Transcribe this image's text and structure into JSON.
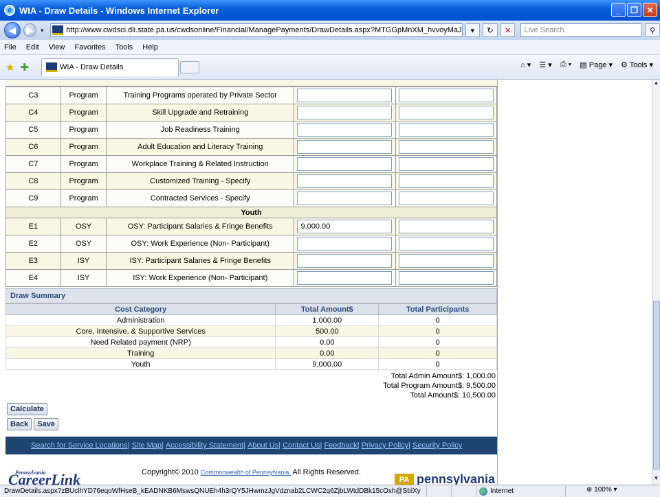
{
  "window": {
    "title": "WIA - Draw Details - Windows Internet Explorer"
  },
  "browser": {
    "url": "http://www.cwdsci.dli.state.pa.us/cwdsonline/Financial/ManagePayments/DrawDetails.aspx?MTGGpMnXM_hvvoyMaJMn2n0I",
    "search_placeholder": "Live Search",
    "menu": [
      "File",
      "Edit",
      "View",
      "Favorites",
      "Tools",
      "Help"
    ],
    "tab_title": "WIA - Draw Details",
    "command_bar": {
      "page": "Page",
      "tools": "Tools"
    }
  },
  "lines": [
    {
      "code": "C3",
      "type": "Program",
      "desc": "Training Programs operated by Private Sector",
      "amount": "",
      "participants": ""
    },
    {
      "code": "C4",
      "type": "Program",
      "desc": "Skill Upgrade and Retraining",
      "amount": "",
      "participants": ""
    },
    {
      "code": "C5",
      "type": "Program",
      "desc": "Job Readiness Training",
      "amount": "",
      "participants": ""
    },
    {
      "code": "C6",
      "type": "Program",
      "desc": "Adult Education and Literacy Training",
      "amount": "",
      "participants": ""
    },
    {
      "code": "C7",
      "type": "Program",
      "desc": "Workplace Training & Related Instruction",
      "amount": "",
      "participants": ""
    },
    {
      "code": "C8",
      "type": "Program",
      "desc": "Customized Training - Specify",
      "amount": "",
      "participants": ""
    },
    {
      "code": "C9",
      "type": "Program",
      "desc": "Contracted Services - Specify",
      "amount": "",
      "participants": ""
    }
  ],
  "youth_header": "Youth",
  "youth_lines": [
    {
      "code": "E1",
      "type": "OSY",
      "desc": "OSY: Participant Salaries & Fringe Benefits",
      "amount": "9,000.00",
      "participants": ""
    },
    {
      "code": "E2",
      "type": "OSY",
      "desc": "OSY: Work Experience (Non- Participant)",
      "amount": "",
      "participants": ""
    },
    {
      "code": "E3",
      "type": "ISY",
      "desc": "ISY: Participant Salaries & Fringe Benefits",
      "amount": "",
      "participants": ""
    },
    {
      "code": "E4",
      "type": "ISY",
      "desc": "ISY: Work Experience (Non- Participant)",
      "amount": "",
      "participants": ""
    }
  ],
  "draw_summary": {
    "title": "Draw Summary",
    "headers": [
      "Cost Category",
      "Total Amount$",
      "Total Participants"
    ],
    "rows": [
      [
        "Administration",
        "1,000.00",
        "0"
      ],
      [
        "Core, Intensive, & Supportive Services",
        "500.00",
        "0"
      ],
      [
        "Need Related payment (NRP)",
        "0.00",
        "0"
      ],
      [
        "Training",
        "0.00",
        "0"
      ],
      [
        "Youth",
        "9,000.00",
        "0"
      ]
    ],
    "total_admin": "Total Admin Amount$: 1,000.00",
    "total_program": "Total Program Amount$: 9,500.00",
    "total_amount": "Total Amount$: 10,500.00"
  },
  "buttons": {
    "calculate": "Calculate",
    "back": "Back",
    "save": "Save"
  },
  "footer": {
    "links": [
      "Search for Service Locations",
      "Site Map",
      "Accessibility Statement",
      "About Us",
      "Contact Us",
      "Feedback",
      "Privacy Policy",
      "Security Policy"
    ],
    "copyright_prefix": "Copyright© 2010",
    "copyright_link": "Commonwealth of Pennsylvania.",
    "copyright_suffix": "All Rights Reserved.",
    "logo_left_small": "Pennsylvania",
    "logo_left": "CareerLink",
    "logo_right": "pennsylvania"
  },
  "status": {
    "url": "DrawDetails.aspx?zBUclhYD76eqoWfHseB_kEADNKB6MswsQNUEh4h3rQY5JHwmzJgVdznab2LCWC2q6ZjbLWtdDBk15cOxh@SblXy",
    "zone": "Internet",
    "zoom": "100%"
  }
}
